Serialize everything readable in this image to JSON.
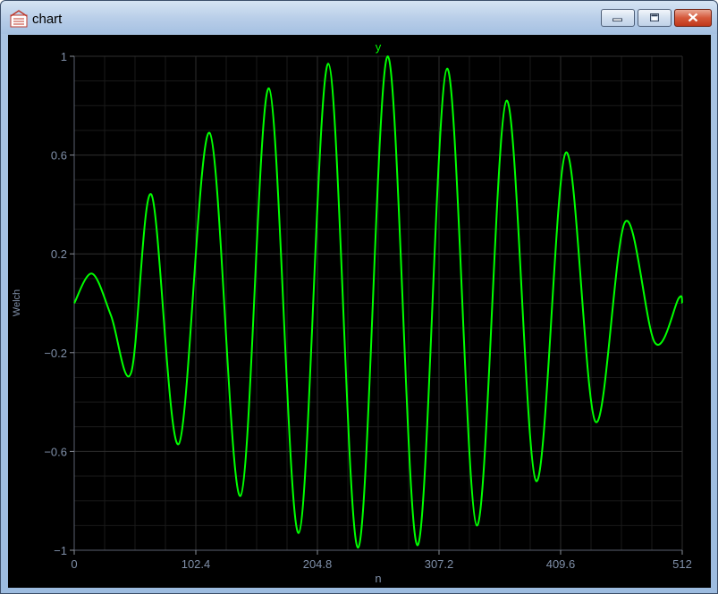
{
  "window": {
    "title": "chart",
    "icons": {
      "app": "chart-icon",
      "minimize": "minimize-icon",
      "maximize": "maximize-icon",
      "close": "close-icon"
    }
  },
  "colors": {
    "background": "#000000",
    "series": "#00ff00",
    "axis_text": "#7f8fa8",
    "grid_major": "#2e2e2e",
    "grid_minor": "#1a1a1a",
    "title": "#00ff00"
  },
  "chart_data": {
    "type": "line",
    "title": "y",
    "xlabel": "n",
    "ylabel": "Welch",
    "xlim": [
      0,
      512
    ],
    "ylim": [
      -1,
      1
    ],
    "grid": true,
    "x_ticks": [
      0,
      102.4,
      204.8,
      307.2,
      409.6,
      512
    ],
    "x_tick_labels": [
      "0",
      "102.4",
      "204.8",
      "307.2",
      "409.6",
      "512"
    ],
    "y_ticks": [
      1,
      0.6,
      0.2,
      -0.2,
      -0.6,
      -1
    ],
    "y_tick_labels": [
      "1",
      "0.6",
      "0.2",
      "−0.2",
      "−0.6",
      "−1"
    ],
    "series": [
      {
        "color": "#00ff00",
        "x": [
          0,
          15,
          31,
          48,
          65,
          88,
          114,
          140,
          164,
          189,
          214,
          239,
          264,
          289,
          314,
          339,
          364,
          389,
          414,
          439,
          464,
          489,
          509,
          512
        ],
        "y": [
          0,
          0.12,
          -0.05,
          -0.28,
          0.44,
          -0.57,
          0.69,
          -0.78,
          0.87,
          -0.93,
          0.97,
          -0.99,
          1.0,
          -0.98,
          0.95,
          -0.9,
          0.82,
          -0.72,
          0.61,
          -0.48,
          0.33,
          -0.16,
          0.02,
          0.0
        ]
      }
    ]
  }
}
